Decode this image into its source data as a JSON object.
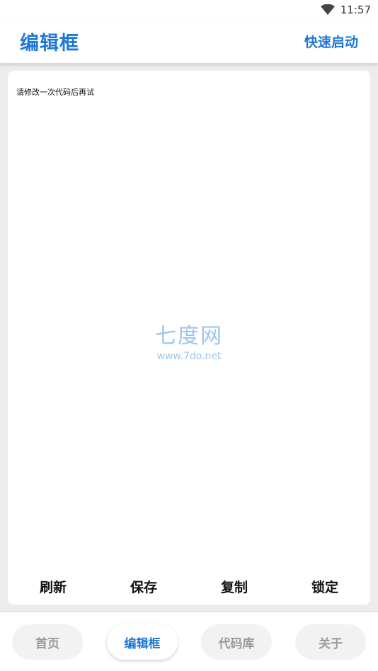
{
  "status_bar": {
    "time": "11:57",
    "icons": [
      "wifi-icon"
    ]
  },
  "app_bar": {
    "title": "编辑框",
    "quick_start_label": "快速启动"
  },
  "editor": {
    "content": "请修改一次代码后再试"
  },
  "watermark": {
    "name": "七度网",
    "url": "www.7do.net"
  },
  "actions": {
    "refresh": "刷新",
    "save": "保存",
    "copy": "复制",
    "lock": "锁定"
  },
  "bottom_nav": {
    "items": [
      {
        "label": "首页",
        "active": false
      },
      {
        "label": "编辑框",
        "active": true
      },
      {
        "label": "代码库",
        "active": false
      },
      {
        "label": "关于",
        "active": false
      }
    ]
  },
  "colors": {
    "accent": "#1e78d7",
    "background": "#ececec",
    "inactive_text": "#9a9a9a",
    "watermark": "#9cc6ee"
  }
}
